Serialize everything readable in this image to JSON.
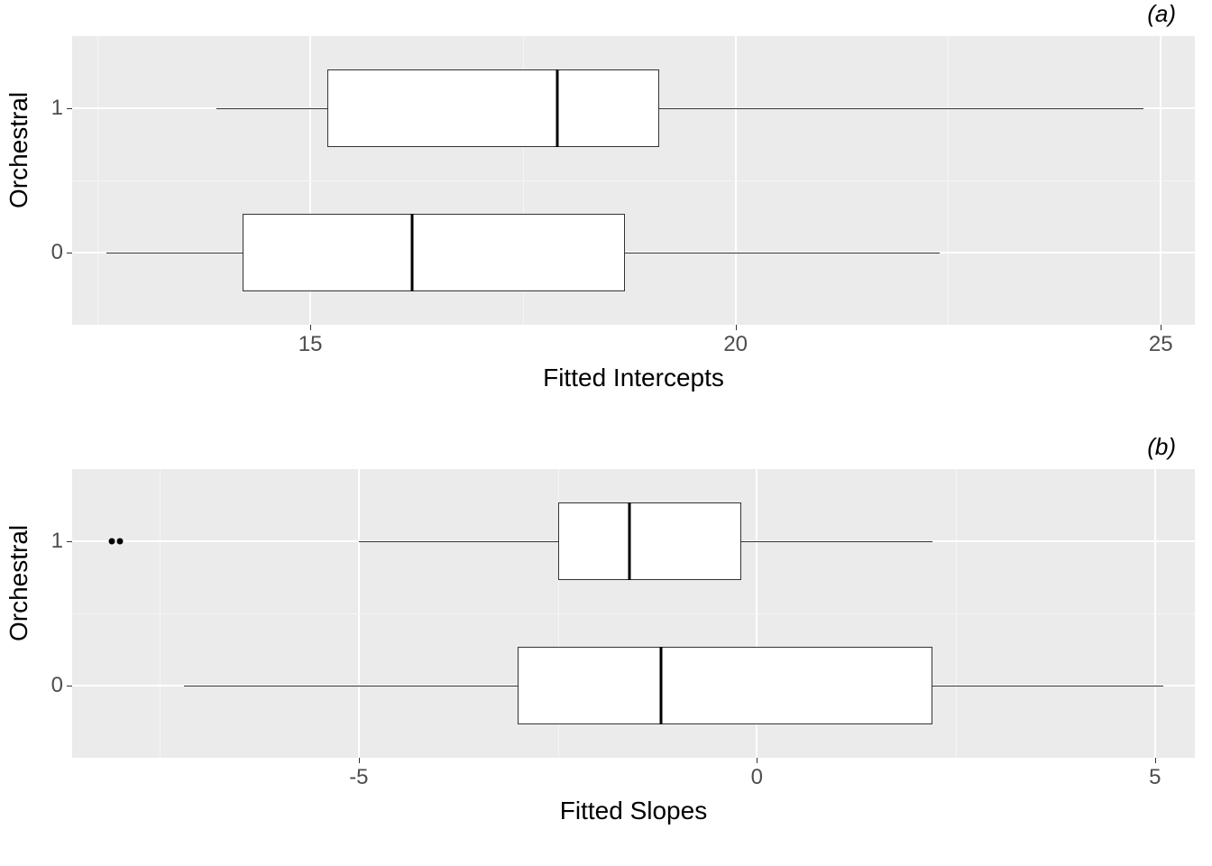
{
  "chart_data": [
    {
      "type": "boxplot",
      "title": "(a)",
      "xlabel": "Fitted Intercepts",
      "ylabel": "Orchestral",
      "xlim": [
        12.2,
        25.4
      ],
      "xticks": [
        15,
        20,
        25
      ],
      "categories": [
        "0",
        "1"
      ],
      "series": [
        {
          "name": "0",
          "min": 12.6,
          "q1": 14.2,
          "median": 16.2,
          "q3": 18.7,
          "max": 22.4,
          "outliers": []
        },
        {
          "name": "1",
          "min": 13.9,
          "q1": 15.2,
          "median": 17.9,
          "q3": 19.1,
          "max": 24.8,
          "outliers": []
        }
      ]
    },
    {
      "type": "boxplot",
      "title": "(b)",
      "xlabel": "Fitted Slopes",
      "ylabel": "Orchestral",
      "xlim": [
        -8.6,
        5.5
      ],
      "xticks": [
        -5,
        0,
        5
      ],
      "categories": [
        "0",
        "1"
      ],
      "series": [
        {
          "name": "0",
          "min": -7.2,
          "q1": -3.0,
          "median": -1.2,
          "q3": 2.2,
          "max": 5.1,
          "outliers": []
        },
        {
          "name": "1",
          "min": -5.0,
          "q1": -2.5,
          "median": -1.6,
          "q3": -0.2,
          "max": 2.2,
          "outliers": [
            -8.1,
            -8.0
          ]
        }
      ]
    }
  ]
}
